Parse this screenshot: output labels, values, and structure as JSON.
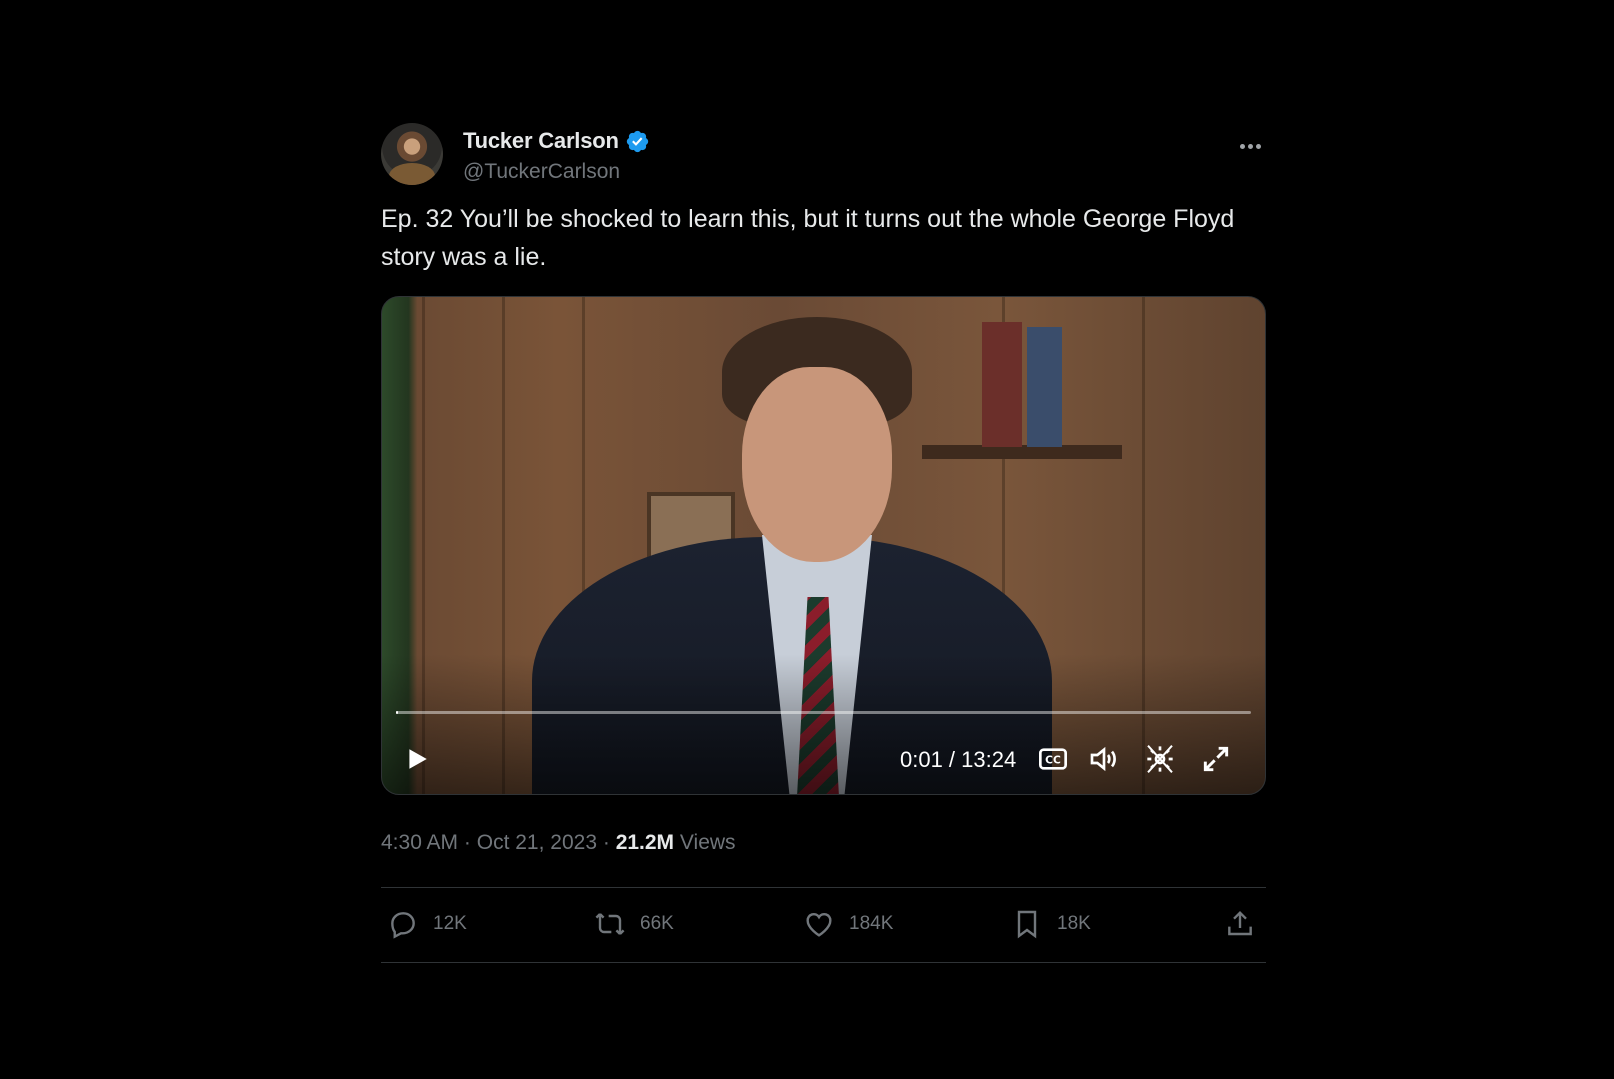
{
  "author": {
    "name": "Tucker Carlson",
    "handle": "@TuckerCarlson",
    "verified_color": "#1d9bf0"
  },
  "tweet": {
    "text": "Ep. 32  You’ll be shocked to learn this, but it turns out the whole George Floyd story was a lie."
  },
  "video": {
    "time_display": "0:01 / 13:24",
    "progress_fraction": 0.001,
    "icons": [
      "play-icon",
      "captions-icon",
      "volume-icon",
      "settings-icon",
      "fullscreen-icon"
    ]
  },
  "meta": {
    "time": "4:30 AM",
    "dot1": "·",
    "date": "Oct 21, 2023",
    "dot2": "·",
    "views_count": "21.2M",
    "views_label": "Views"
  },
  "actions": {
    "replies": "12K",
    "reposts": "66K",
    "likes": "184K",
    "bookmarks": "18K"
  }
}
